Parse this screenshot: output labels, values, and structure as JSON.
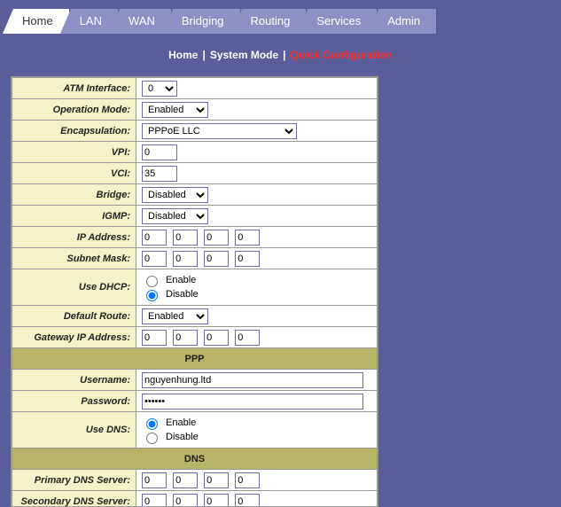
{
  "tabs": [
    "Home",
    "LAN",
    "WAN",
    "Bridging",
    "Routing",
    "Services",
    "Admin"
  ],
  "active_tab": 0,
  "breadcrumb": {
    "a": "Home",
    "b": "System Mode",
    "c": "Quick Configuration",
    "sep": "|"
  },
  "labels": {
    "atm": "ATM Interface:",
    "opmode": "Operation Mode:",
    "encap": "Encapsulation:",
    "vpi": "VPI:",
    "vci": "VCI:",
    "bridge": "Bridge:",
    "igmp": "IGMP:",
    "ip": "IP Address:",
    "mask": "Subnet Mask:",
    "dhcp": "Use DHCP:",
    "defroute": "Default Route:",
    "gw": "Gateway IP Address:",
    "ppp": "PPP",
    "user": "Username:",
    "pass": "Password:",
    "usedns": "Use DNS:",
    "dns": "DNS",
    "pdns": "Primary DNS Server:",
    "sdns": "Secondary DNS Server:"
  },
  "values": {
    "atm": "0",
    "opmode": "Enabled",
    "encap": "PPPoE LLC",
    "vpi": "0",
    "vci": "35",
    "bridge": "Disabled",
    "igmp": "Disabled",
    "ip": [
      "0",
      "0",
      "0",
      "0"
    ],
    "mask": [
      "0",
      "0",
      "0",
      "0"
    ],
    "dhcp": "disable",
    "defroute": "Enabled",
    "gw": [
      "0",
      "0",
      "0",
      "0"
    ],
    "user": "nguyenhung.ltd",
    "pass": "••••••",
    "usedns": "enable",
    "pdns": [
      "0",
      "0",
      "0",
      "0"
    ],
    "sdns": [
      "0",
      "0",
      "0",
      "0"
    ]
  },
  "radio": {
    "enable": "Enable",
    "disable": "Disable"
  }
}
